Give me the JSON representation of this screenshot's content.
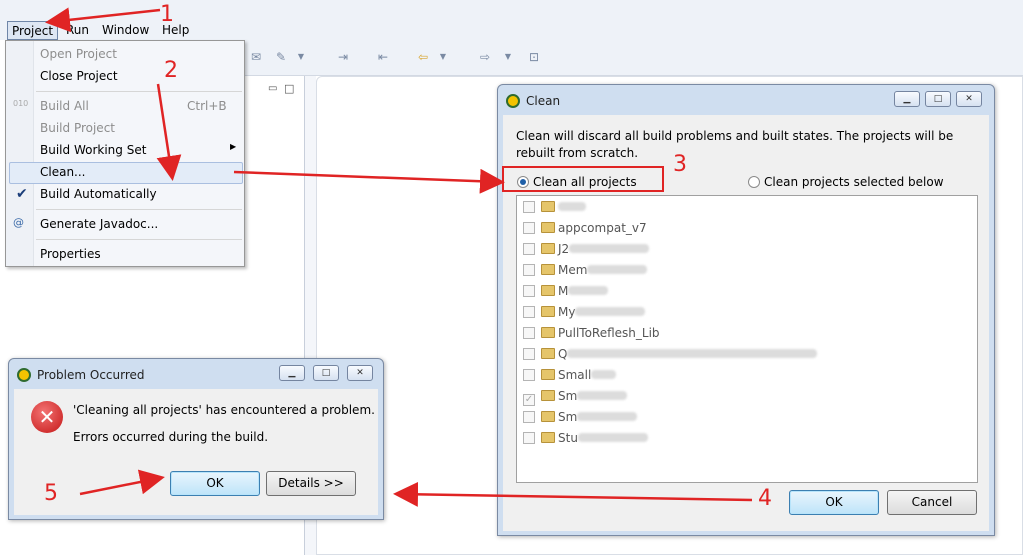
{
  "menubar": {
    "items": [
      "Project",
      "Run",
      "Window",
      "Help"
    ]
  },
  "dropdown": {
    "open_project": "Open Project",
    "close_project": "Close Project",
    "build_all": "Build All",
    "build_all_shortcut": "Ctrl+B",
    "build_project": "Build Project",
    "build_working_set": "Build Working Set",
    "clean": "Clean...",
    "build_automatically": "Build Automatically",
    "build_automatically_checked": true,
    "generate_javadoc": "Generate Javadoc...",
    "properties": "Properties"
  },
  "clean_dialog": {
    "title": "Clean",
    "message": "Clean will discard all build problems and built states.  The projects will be rebuilt from scratch.",
    "radio_all": "Clean all projects",
    "radio_all_selected": true,
    "radio_selected": "Clean projects selected below",
    "projects": [
      {
        "name": "",
        "checked": false
      },
      {
        "name": "appcompat_v7",
        "checked": false
      },
      {
        "name": "J2",
        "checked": false
      },
      {
        "name": "Mem",
        "checked": false
      },
      {
        "name": "M",
        "checked": false
      },
      {
        "name": "My",
        "checked": false
      },
      {
        "name": "PullToReflesh_Lib",
        "checked": false
      },
      {
        "name": "Q",
        "checked": false
      },
      {
        "name": "Small",
        "checked": false
      },
      {
        "name": "Sm",
        "checked": true
      },
      {
        "name": "Sm",
        "checked": false
      },
      {
        "name": "Stu",
        "checked": false
      }
    ],
    "ok_label": "OK",
    "cancel_label": "Cancel"
  },
  "problem_dialog": {
    "title": "Problem Occurred",
    "message_line1": "'Cleaning all projects' has encountered a problem.",
    "message_line2": "Errors occurred during the build.",
    "ok_label": "OK",
    "details_label": "Details >>"
  },
  "annotations": {
    "step1": "1",
    "step2": "2",
    "step3": "3",
    "step4": "4",
    "step5": "5",
    "color": "#e02424"
  }
}
